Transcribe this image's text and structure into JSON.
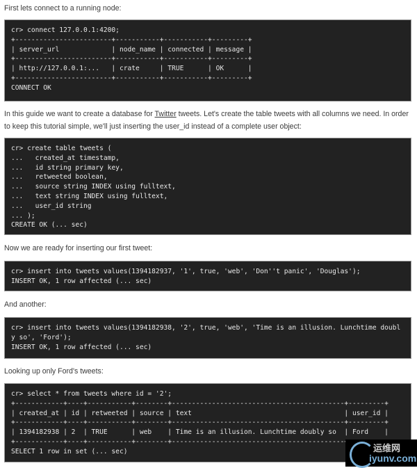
{
  "paragraphs": {
    "p1": "First lets connect to a running node:",
    "p2_before": "In this guide we want to create a database for ",
    "p2_link": "Twitter",
    "p2_after": " tweets. Let's create the table tweets with all columns we need. In order to keep this tutorial simple, we'll just inserting the user_id instead of a complete user object:",
    "p3": "Now we are ready for inserting our first tweet:",
    "p4": "And another:",
    "p5": "Looking up only Ford's tweets:"
  },
  "code": {
    "connect": "cr> connect 127.0.0.1:4200;\n+------------------------+-----------+-----------+---------+\n| server_url             | node_name | connected | message |\n+------------------------+-----------+-----------+---------+\n| http://127.0.0.1:...   | crate     | TRUE      | OK      |\n+------------------------+-----------+-----------+---------+\nCONNECT OK",
    "create": "cr> create table tweets (\n...   created_at timestamp,\n...   id string primary key,\n...   retweeted boolean,\n...   source string INDEX using fulltext,\n...   text string INDEX using fulltext,\n...   user_id string\n... );\nCREATE OK (... sec)",
    "insert1": "cr> insert into tweets values(1394182937, '1', true, 'web', 'Don''t panic', 'Douglas');\nINSERT OK, 1 row affected (... sec)",
    "insert2": "cr> insert into tweets values(1394182938, '2', true, 'web', 'Time is an illusion. Lunchtime doubl\ny so', 'Ford');\nINSERT OK, 1 row affected (... sec)",
    "select": "cr> select * from tweets where id = '2';\n+------------+----+-----------+--------+-------------------------------------------+---------+\n| created_at | id | retweeted | source | text                                      | user_id |\n+------------+----+-----------+--------+-------------------------------------------+---------+\n| 1394182938 | 2  | TRUE      | web    | Time is an illusion. Lunchtime doubly so  | Ford    |\n+------------+----+-----------+--------+-------------------------------------------+---------+\nSELECT 1 row in set (... sec)"
  },
  "watermark": {
    "cn": "运维网",
    "en": "iyunv.com"
  }
}
